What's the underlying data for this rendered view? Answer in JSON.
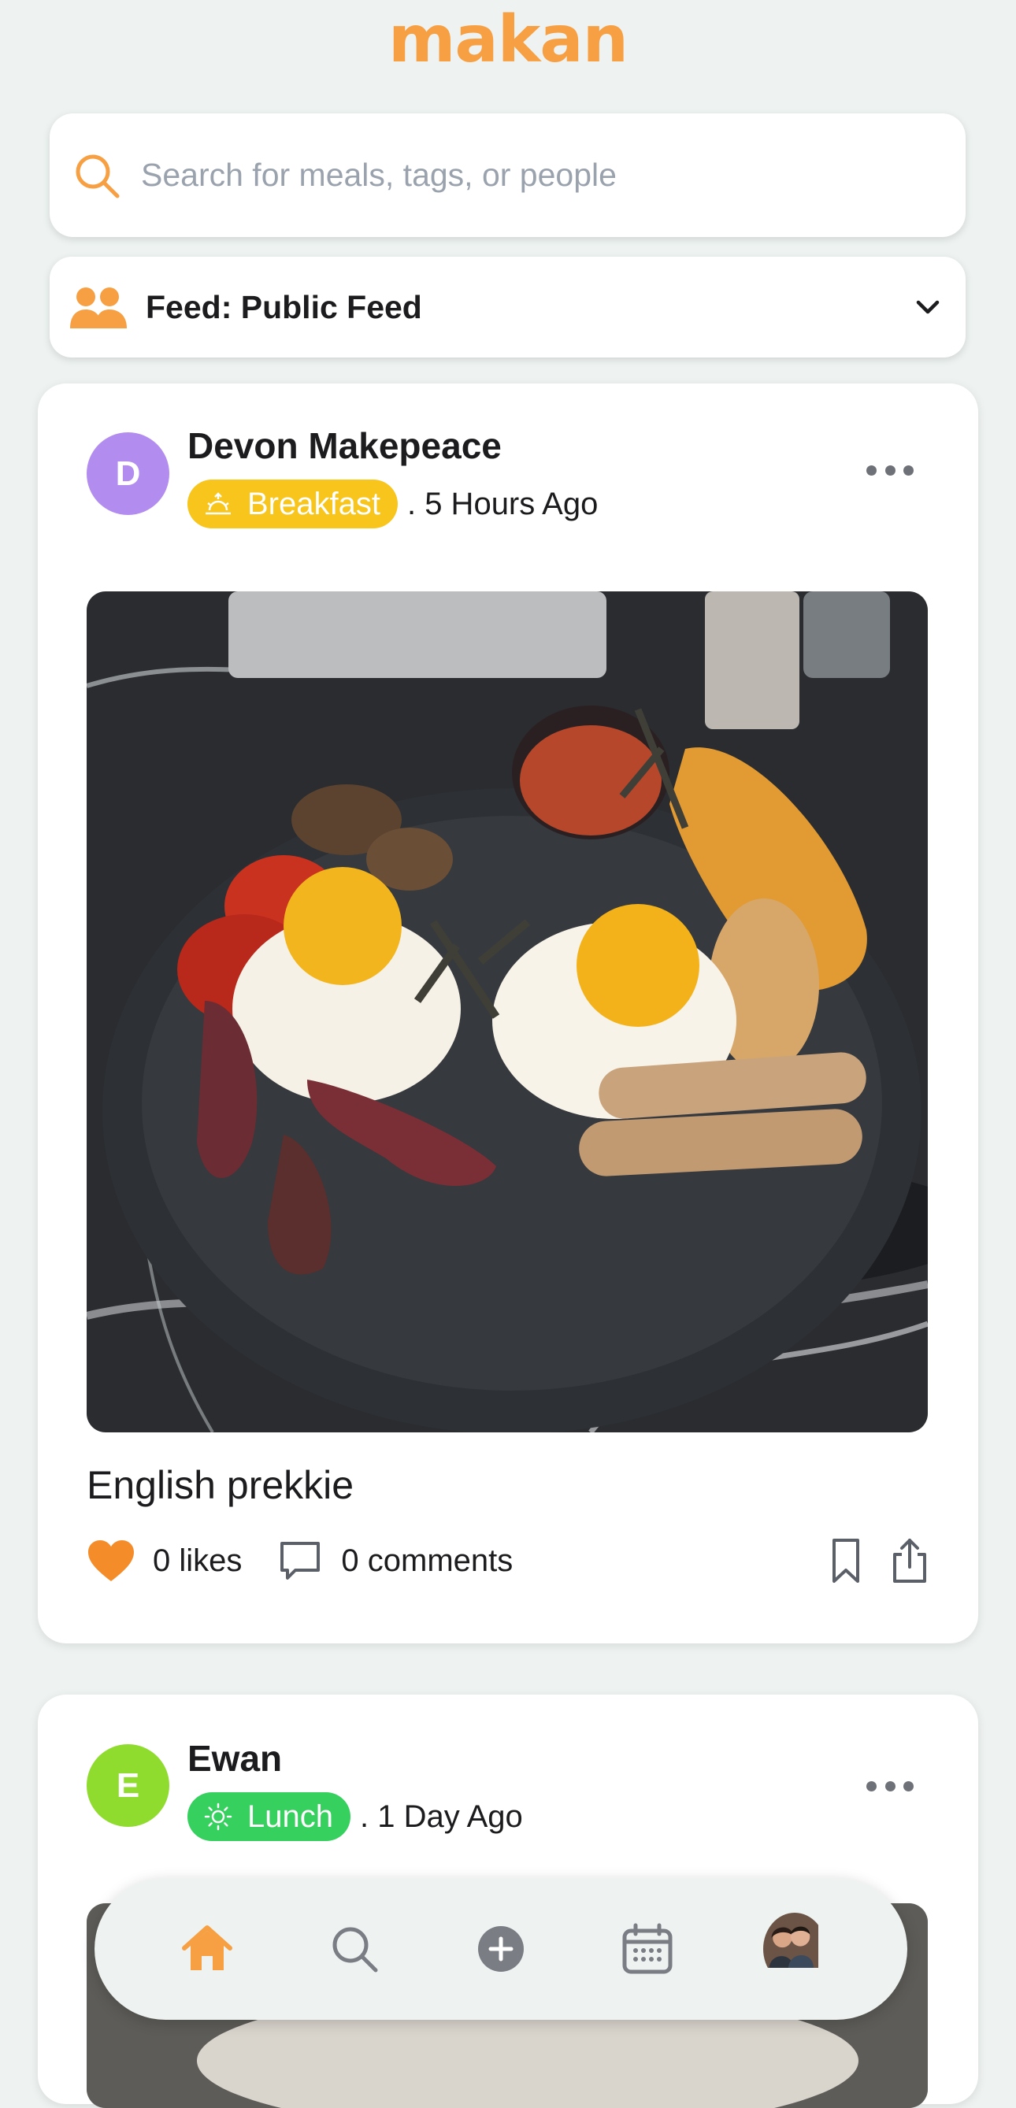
{
  "app": {
    "logo": "makan"
  },
  "search": {
    "placeholder": "Search for meals, tags, or people"
  },
  "feed_selector": {
    "label": "Feed: Public Feed"
  },
  "posts": [
    {
      "user": {
        "initial": "D",
        "name": "Devon Makepeace",
        "avatar_color": "#b38cf0"
      },
      "meal": {
        "label": "Breakfast",
        "color": "#f8c51c",
        "icon": "sunrise-icon"
      },
      "time": ". 5 Hours Ago",
      "caption": "English prekkie",
      "likes": "0 likes",
      "comments": "0 comments"
    },
    {
      "user": {
        "initial": "E",
        "name": "Ewan",
        "avatar_color": "#8fdc2f"
      },
      "meal": {
        "label": "Lunch",
        "color": "#36d05e",
        "icon": "sun-icon"
      },
      "time": ". 1 Day Ago"
    }
  ],
  "colors": {
    "accent": "#f7a043",
    "background": "#eef3f1"
  },
  "bottom_nav": {
    "items": [
      "home-icon",
      "search-icon",
      "add-icon",
      "calendar-icon",
      "profile-avatar"
    ],
    "active": "home-icon"
  }
}
